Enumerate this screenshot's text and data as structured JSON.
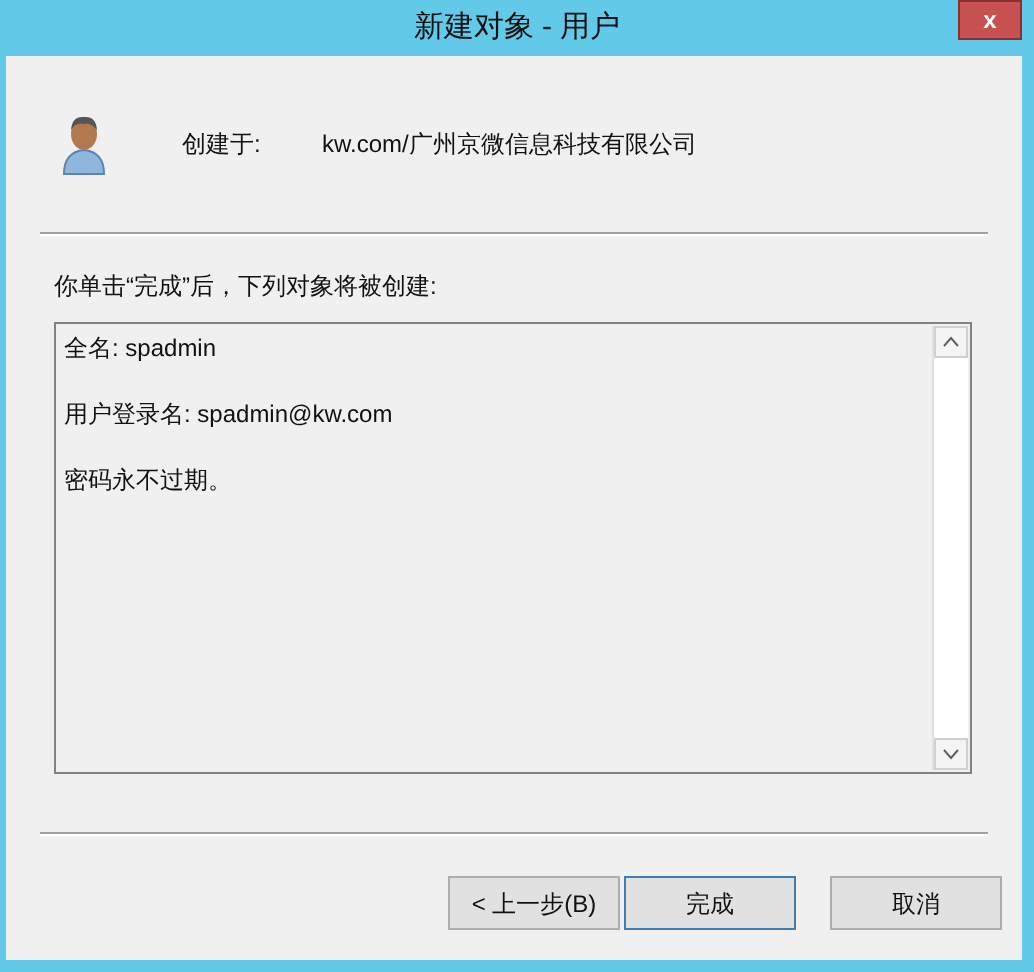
{
  "window": {
    "title": "新建对象 - 用户",
    "close": "x"
  },
  "created_in": {
    "label": "创建于:",
    "value": "kw.com/广州京微信息科技有限公司"
  },
  "instruction": "你单击“完成”后，下列对象将被创建:",
  "summary_lines": [
    "全名: spadmin",
    "用户登录名: spadmin@kw.com",
    "密码永不过期。"
  ],
  "buttons": [
    {
      "label": "< 上一步(B)",
      "focused": false
    },
    {
      "label": "完成",
      "focused": true
    },
    {
      "label": "取消",
      "focused": false
    }
  ]
}
